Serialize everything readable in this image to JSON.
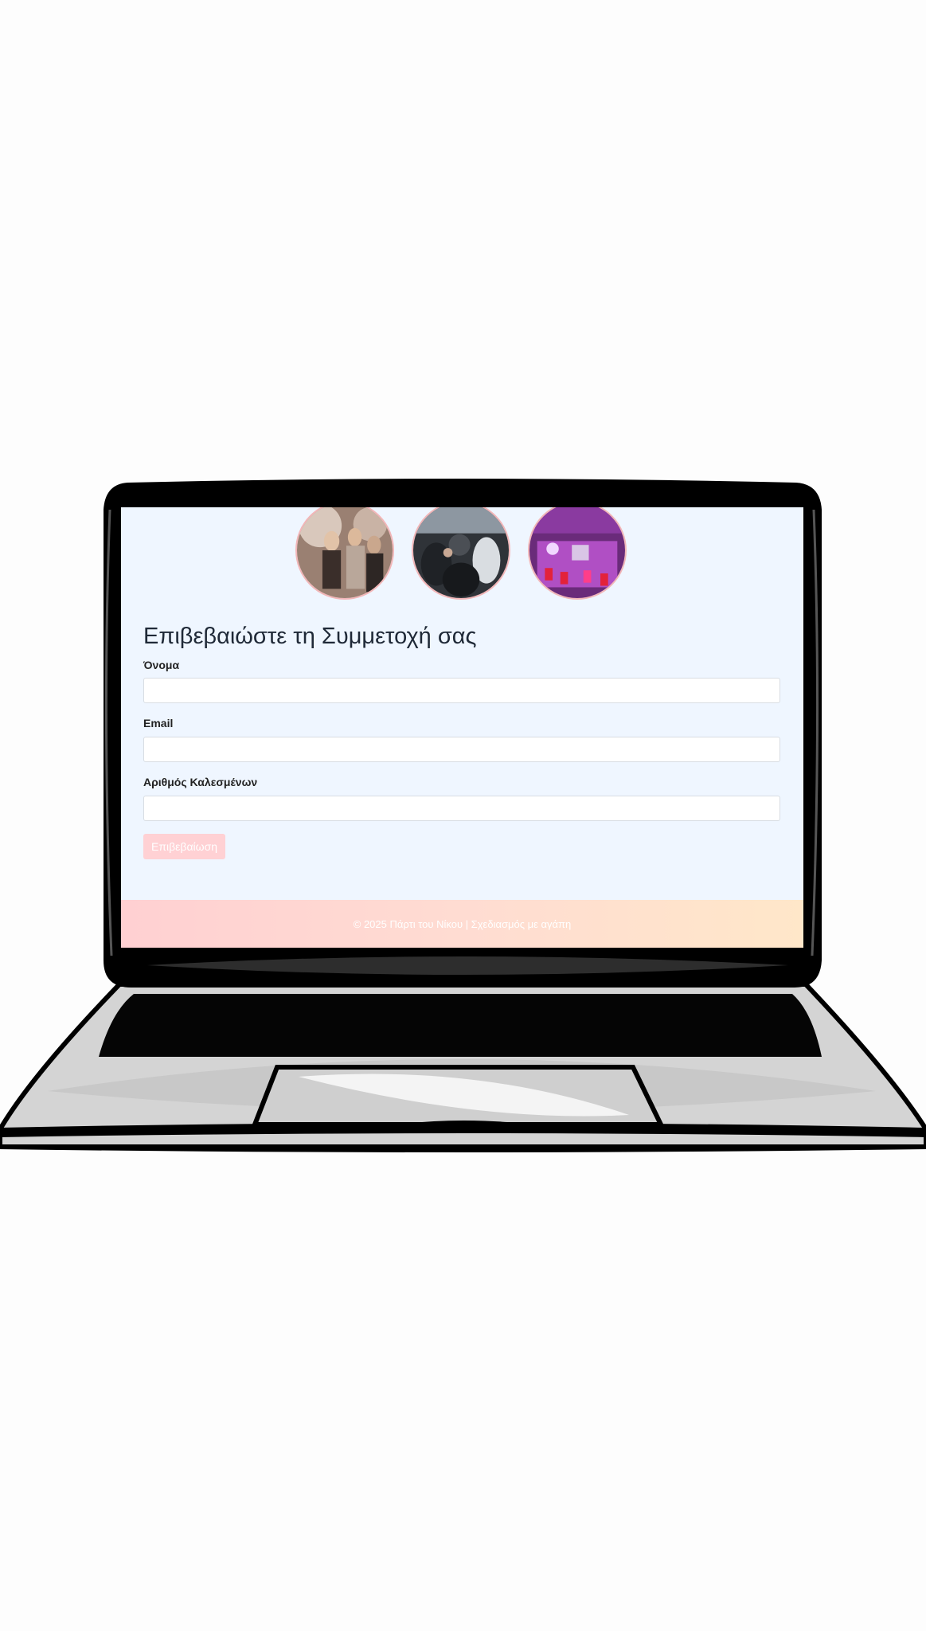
{
  "gallery": {
    "photos": [
      {
        "name": "party-photo-1"
      },
      {
        "name": "party-photo-2"
      },
      {
        "name": "party-photo-3"
      }
    ]
  },
  "rsvp": {
    "title": "Επιβεβαιώστε τη Συμμετοχή σας",
    "name_label": "Όνομα",
    "name_value": "",
    "email_label": "Email",
    "email_value": "",
    "guests_label": "Αριθμός Καλεσμένων",
    "guests_value": "",
    "submit_label": "Επιβεβαίωση"
  },
  "footer": {
    "text": "© 2025 Πάρτι του Νίκου | Σχεδιασμός με αγάπη"
  },
  "colors": {
    "page_bg": "#eff6ff",
    "button_bg": "#ffd1d4",
    "footer_gradient_start": "#ffd0d2",
    "footer_gradient_end": "#ffe7c9"
  }
}
